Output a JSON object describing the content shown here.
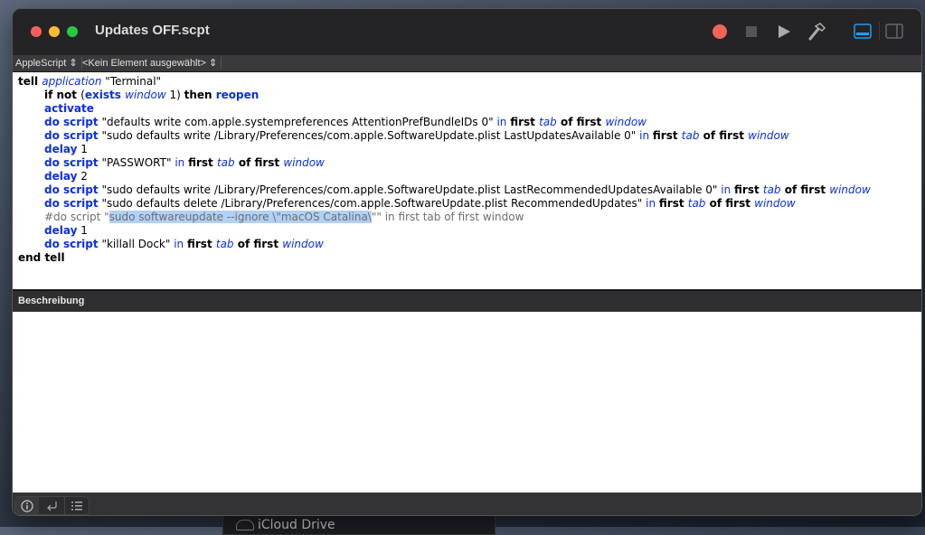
{
  "window": {
    "title": "Updates OFF.scpt"
  },
  "toolbar": {
    "record": "record-button",
    "stop": "stop-button",
    "run": "run-button",
    "compile": "compile-button",
    "colors": {
      "record": "#f0645a",
      "accent": "#1f9bf0"
    }
  },
  "navbar": {
    "language": "AppleScript",
    "element": "<Kein Element ausgewählt>"
  },
  "code": [
    {
      "indent": 0,
      "tokens": [
        {
          "s": "kw",
          "t": "tell "
        },
        {
          "s": "cls",
          "t": "application"
        },
        {
          "s": "txt",
          "t": " \"Terminal\""
        }
      ]
    },
    {
      "indent": 1,
      "tokens": [
        {
          "s": "kw",
          "t": "if not "
        },
        {
          "s": "txt",
          "t": "("
        },
        {
          "s": "cmd",
          "t": "exists "
        },
        {
          "s": "cls",
          "t": "window"
        },
        {
          "s": "txt",
          "t": " 1) "
        },
        {
          "s": "kw",
          "t": "then "
        },
        {
          "s": "cmd",
          "t": "reopen"
        }
      ]
    },
    {
      "indent": 1,
      "tokens": [
        {
          "s": "cmd",
          "t": "activate"
        }
      ]
    },
    {
      "indent": 1,
      "tokens": [
        {
          "s": "cmd",
          "t": "do script"
        },
        {
          "s": "txt",
          "t": " \"defaults write com.apple.systempreferences AttentionPrefBundleIDs 0\" "
        },
        {
          "s": "prep",
          "t": "in "
        },
        {
          "s": "kw",
          "t": "first "
        },
        {
          "s": "cls",
          "t": "tab"
        },
        {
          "s": "kw",
          "t": " of first "
        },
        {
          "s": "cls",
          "t": "window"
        }
      ]
    },
    {
      "indent": 1,
      "tokens": [
        {
          "s": "cmd",
          "t": "do script"
        },
        {
          "s": "txt",
          "t": " \"sudo defaults write /Library/Preferences/com.apple.SoftwareUpdate.plist LastUpdatesAvailable 0\" "
        },
        {
          "s": "prep",
          "t": "in "
        },
        {
          "s": "kw",
          "t": "first "
        },
        {
          "s": "cls",
          "t": "tab"
        },
        {
          "s": "kw",
          "t": " of first "
        },
        {
          "s": "cls",
          "t": "window"
        }
      ]
    },
    {
      "indent": 1,
      "tokens": [
        {
          "s": "cmd",
          "t": "delay"
        },
        {
          "s": "txt",
          "t": " 1"
        }
      ]
    },
    {
      "indent": 1,
      "tokens": [
        {
          "s": "cmd",
          "t": "do script"
        },
        {
          "s": "txt",
          "t": " \"PASSWORT\" "
        },
        {
          "s": "prep",
          "t": "in "
        },
        {
          "s": "kw",
          "t": "first "
        },
        {
          "s": "cls",
          "t": "tab"
        },
        {
          "s": "kw",
          "t": " of first "
        },
        {
          "s": "cls",
          "t": "window"
        }
      ]
    },
    {
      "indent": 1,
      "tokens": [
        {
          "s": "cmd",
          "t": "delay"
        },
        {
          "s": "txt",
          "t": " 2"
        }
      ]
    },
    {
      "indent": 1,
      "tokens": [
        {
          "s": "cmd",
          "t": "do script"
        },
        {
          "s": "txt",
          "t": " \"sudo defaults write /Library/Preferences/com.apple.SoftwareUpdate.plist LastRecommendedUpdatesAvailable 0\" "
        },
        {
          "s": "prep",
          "t": "in "
        },
        {
          "s": "kw",
          "t": "first "
        },
        {
          "s": "cls",
          "t": "tab"
        },
        {
          "s": "kw",
          "t": " of first "
        },
        {
          "s": "cls",
          "t": "window"
        }
      ]
    },
    {
      "indent": 1,
      "tokens": [
        {
          "s": "cmd",
          "t": "do script"
        },
        {
          "s": "txt",
          "t": " \"sudo defaults delete /Library/Preferences/com.apple.SoftwareUpdate.plist RecommendedUpdates\" "
        },
        {
          "s": "prep",
          "t": "in "
        },
        {
          "s": "kw",
          "t": "first "
        },
        {
          "s": "cls",
          "t": "tab"
        },
        {
          "s": "kw",
          "t": " of first "
        },
        {
          "s": "cls",
          "t": "window"
        }
      ]
    },
    {
      "indent": 1,
      "tokens": [
        {
          "s": "cmt",
          "t": "#do script \""
        },
        {
          "s": "hl",
          "t": "sudo softwareupdate --ignore \\\"macOS Catalina\\"
        },
        {
          "s": "cmt",
          "t": "\"\" in first tab of first window"
        }
      ]
    },
    {
      "indent": 1,
      "tokens": [
        {
          "s": "cmd",
          "t": "delay"
        },
        {
          "s": "txt",
          "t": " 1"
        }
      ]
    },
    {
      "indent": 1,
      "tokens": [
        {
          "s": "cmd",
          "t": "do script"
        },
        {
          "s": "txt",
          "t": " \"killall Dock\" "
        },
        {
          "s": "prep",
          "t": "in "
        },
        {
          "s": "kw",
          "t": "first "
        },
        {
          "s": "cls",
          "t": "tab"
        },
        {
          "s": "kw",
          "t": " of first "
        },
        {
          "s": "cls",
          "t": "window"
        }
      ]
    },
    {
      "indent": 0,
      "tokens": [
        {
          "s": "kw",
          "t": "end tell"
        }
      ]
    }
  ],
  "description": {
    "header": "Beschreibung",
    "body": ""
  },
  "background": {
    "window_label": "iCloud Drive"
  }
}
